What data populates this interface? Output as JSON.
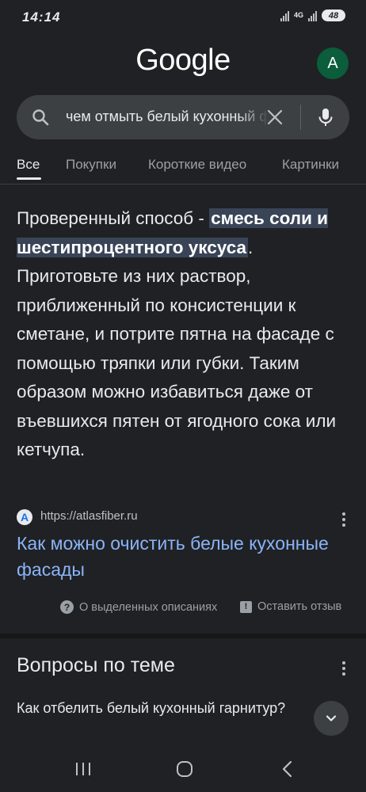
{
  "status_bar": {
    "time": "14:14",
    "network": "4G",
    "battery": "48"
  },
  "header": {
    "logo": "Google",
    "avatar_letter": "A"
  },
  "search": {
    "query": "чем отмыть белый кухонный фасад"
  },
  "tabs": [
    {
      "label": "Все",
      "active": true
    },
    {
      "label": "Покупки",
      "active": false
    },
    {
      "label": "Короткие видео",
      "active": false
    },
    {
      "label": "Картинки",
      "active": false
    }
  ],
  "featured_snippet": {
    "text_before": "Проверенный способ - ",
    "highlighted": "смесь соли и шестипроцентного уксуса",
    "text_after": ". Приготовьте из них раствор, приближенный по консистенции к сметане, и потрите пятна на фасаде с помощью тряпки или губки. Таким образом можно избавиться даже от въевшихся пятен от ягодного сока или кетчупа.",
    "source_favicon": "A",
    "source_url": "https://atlasfiber.ru",
    "link_title": "Как можно очистить белые кухонные фасады",
    "about_label": "О выделенных описаниях",
    "feedback_label": "Оставить отзыв"
  },
  "related_questions": {
    "title": "Вопросы по теме",
    "items": [
      {
        "question": "Как отбелить белый кухонный гарнитур?"
      }
    ]
  },
  "colors": {
    "background": "#202124",
    "link": "#8ab4f8",
    "highlight": "#394457",
    "avatar": "#0b5d3b"
  }
}
